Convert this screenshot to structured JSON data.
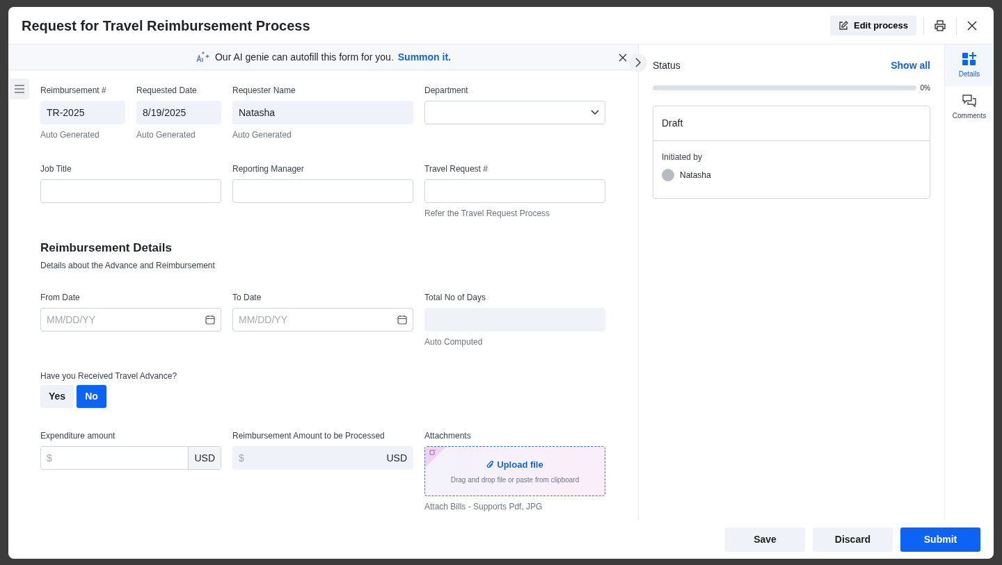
{
  "window": {
    "title": "Request for Travel Reimbursement Process"
  },
  "header_actions": {
    "edit_button": "Edit process"
  },
  "banner": {
    "text": "Our AI genie can autofill this form for you.",
    "link": "Summon it."
  },
  "form": {
    "rows": [
      {
        "fields": [
          {
            "kind": "readonly",
            "label": "Reimbursement #",
            "value": "TR-2025",
            "hint": "Auto Generated"
          },
          {
            "kind": "readonly",
            "label": "Requested Date",
            "value": "8/19/2025",
            "hint": "Auto Generated"
          },
          {
            "kind": "readonly",
            "label": "Requester Name",
            "value": "Natasha",
            "hint": "Auto Generated"
          },
          {
            "kind": "select",
            "label": "Department"
          }
        ]
      },
      {
        "fields": [
          {
            "kind": "input",
            "label": "Job Title"
          },
          {
            "kind": "input",
            "label": "Reporting Manager"
          },
          {
            "kind": "input",
            "label": "Travel Request #",
            "hint": "Refer the Travel Request Process"
          }
        ]
      },
      {
        "heading": "Reimbursement Details",
        "description": "Details about the Advance and Reimbursement"
      },
      {
        "fields": [
          {
            "kind": "date",
            "label": "From Date",
            "placeholder": "MM/DD/YY"
          },
          {
            "kind": "date",
            "label": "To Date",
            "placeholder": "MM/DD/YY"
          },
          {
            "kind": "readonly",
            "label": "Total No of Days",
            "hint": "Auto Computed"
          }
        ]
      },
      {
        "fields": [
          {
            "kind": "toggle",
            "label": "Have you Received Travel Advance?",
            "options": [
              {
                "label": "Yes",
                "selected": false
              },
              {
                "label": "No",
                "selected": true
              }
            ]
          }
        ]
      },
      {
        "fields": [
          {
            "kind": "currency",
            "label": "Expenditure amount",
            "placeholder": "$",
            "unit": "USD",
            "readonly": false
          },
          {
            "kind": "currency",
            "label": "Reimbursement Amount to be Processed",
            "placeholder": "$",
            "unit": "USD",
            "readonly": true
          },
          {
            "kind": "upload",
            "label": "Attachments",
            "link": "Upload file",
            "text": "Drag and drop file or paste from clipboard",
            "hint": "Attach Bills - Supports Pdf, JPG"
          }
        ]
      }
    ]
  },
  "status_panel": {
    "title": "Status",
    "link": "Show all",
    "progress": {
      "level": 0,
      "reading": "0%"
    },
    "card": {
      "title": "Draft",
      "label": "Initiated by",
      "user": "Natasha"
    }
  },
  "side_rail": [
    {
      "label": "Details",
      "selected": true
    },
    {
      "label": "Comments",
      "selected": false
    }
  ],
  "footer_buttons": [
    {
      "label": "Save",
      "kind": "secondary"
    },
    {
      "label": "Discard",
      "kind": "secondary"
    },
    {
      "label": "Submit",
      "kind": "primary"
    }
  ]
}
